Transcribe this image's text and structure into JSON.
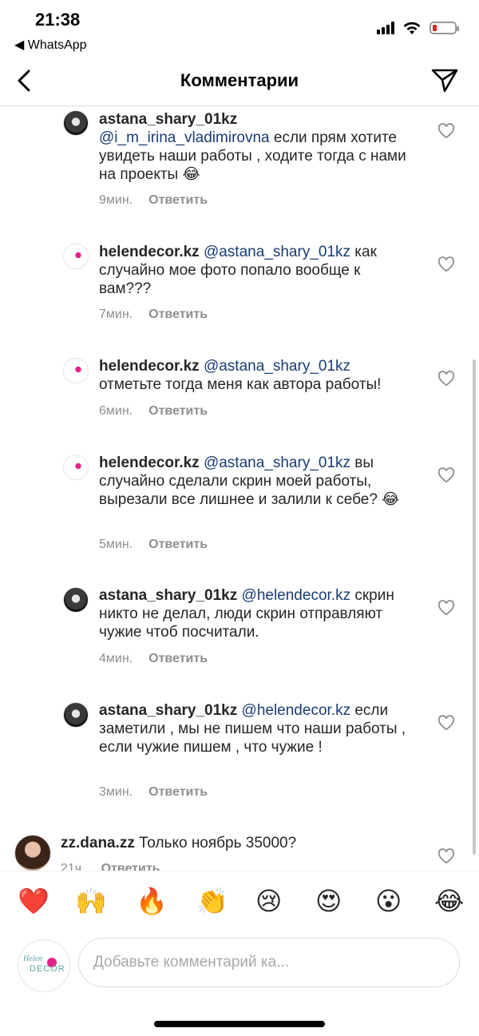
{
  "status": {
    "time": "21:38",
    "back_app": "◀ WhatsApp"
  },
  "nav": {
    "title": "Комментарии",
    "back_icon": "chevron-left-icon",
    "send_icon": "paper-plane-icon"
  },
  "comments": [
    {
      "username": "astana_shary_01kz",
      "mention": "@i_m_irina_vladimirovna",
      "text": " если прям хотите увидеть наши работы , ходите тогда с нами на проекты 😂",
      "time": "9мин.",
      "reply": "Ответить",
      "avatar": "dark"
    },
    {
      "username": "helendecor.kz",
      "mention": "@astana_shary_01kz",
      "text": " как случайно мое фото попало вообще к вам???",
      "time": "7мин.",
      "reply": "Ответить",
      "avatar": "helen"
    },
    {
      "username": "helendecor.kz",
      "mention": "@astana_shary_01kz",
      "text": " отметьте тогда меня как автора работы!",
      "time": "6мин.",
      "reply": "Ответить",
      "avatar": "helen"
    },
    {
      "username": "helendecor.kz",
      "mention": "@astana_shary_01kz",
      "text": " вы случайно сделали скрин моей работы, вырезали все лишнее и залили к себе? 😂",
      "time": "5мин.",
      "reply": "Ответить",
      "avatar": "helen"
    },
    {
      "username": "astana_shary_01kz",
      "mention": "@helendecor.kz",
      "text": " скрин никто не делал, люди скрин отправляют чужие чтоб посчитали.",
      "time": "4мин.",
      "reply": "Ответить",
      "avatar": "dark"
    },
    {
      "username": "astana_shary_01kz",
      "mention": "@helendecor.kz",
      "text": " если заметили , мы не пишем что наши работы , если чужие пишем , что чужие !",
      "time": "3мин.",
      "reply": "Ответить",
      "avatar": "dark"
    },
    {
      "username": "zz.dana.zz",
      "mention": "",
      "text": " Только ноябрь 35000?",
      "time": "21ч.",
      "reply": "Ответить",
      "avatar": "girl"
    }
  ],
  "emojis": [
    "❤️",
    "🙌",
    "🔥",
    "👏",
    "😢",
    "😍",
    "😮",
    "😂"
  ],
  "composer": {
    "placeholder": "Добавьте комментарий ка...",
    "avatar_brand_top": "Helen",
    "avatar_brand": "DECOR"
  }
}
